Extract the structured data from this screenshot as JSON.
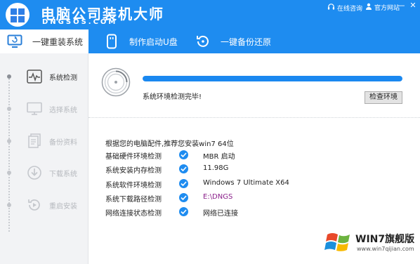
{
  "header": {
    "title": "电脑公司装机大师",
    "subtitle": "DNGSOS.COM",
    "online_consult": "在线咨询",
    "official_site": "官方网站",
    "minimize_glyph": "—",
    "close_glyph": "✕",
    "brand_color": "#1e8cf0"
  },
  "tabs": [
    {
      "label": "一键重装系统",
      "icon": "monitor-icon",
      "active": true
    },
    {
      "label": "制作启动U盘",
      "icon": "usb-icon",
      "active": false
    },
    {
      "label": "一键备份还原",
      "icon": "restore-icon",
      "active": false
    }
  ],
  "sidebar": {
    "steps": [
      {
        "label": "系统检测",
        "icon": "pulse-icon",
        "active": true
      },
      {
        "label": "选择系统",
        "icon": "monitor-icon",
        "active": false
      },
      {
        "label": "备份资料",
        "icon": "document-icon",
        "active": false
      },
      {
        "label": "下载系统",
        "icon": "download-icon",
        "active": false
      },
      {
        "label": "重启安装",
        "icon": "replay-icon",
        "active": false
      }
    ]
  },
  "detection": {
    "progress": 1.0,
    "status": "系统环境检测完毕!",
    "check_button": "检查环境"
  },
  "results": {
    "intro": "根据您的电脑配件,推荐您安装win7 64位",
    "rows": [
      {
        "label": "基础硬件环境检测",
        "value": "MBR 启动"
      },
      {
        "label": "系统安装内存检测",
        "value": "11.98G"
      },
      {
        "label": "系统软件环境检测",
        "value": "Windows 7 Ultimate X64"
      },
      {
        "label": "系统下载路径检测",
        "value": "E:\\DNGS"
      },
      {
        "label": "网络连接状态检测",
        "value": "网络已连接"
      }
    ]
  },
  "watermark": {
    "text": "WIN7旗舰版",
    "url": "www.win7qijian.com"
  }
}
